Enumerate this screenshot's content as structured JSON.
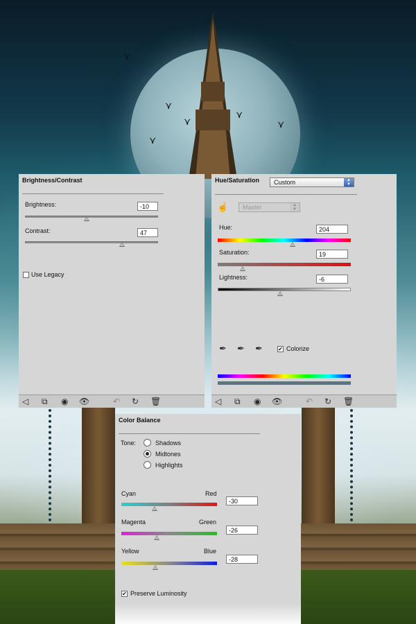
{
  "brightness_contrast": {
    "title": "Brightness/Contrast",
    "brightness_label": "Brightness:",
    "brightness_value": "-10",
    "contrast_label": "Contrast:",
    "contrast_value": "47",
    "use_legacy_label": "Use Legacy",
    "use_legacy_checked": false
  },
  "hue_saturation": {
    "title": "Hue/Saturation",
    "preset": "Custom",
    "channel": "Master",
    "hue_label": "Hue:",
    "hue_value": "204",
    "saturation_label": "Saturation:",
    "saturation_value": "19",
    "lightness_label": "Lightness:",
    "lightness_value": "-6",
    "colorize_label": "Colorize",
    "colorize_checked": true
  },
  "color_balance": {
    "title": "Color Balance",
    "tone_label": "Tone:",
    "tones": [
      "Shadows",
      "Midtones",
      "Highlights"
    ],
    "selected_tone": "Midtones",
    "cyan_label": "Cyan",
    "red_label": "Red",
    "cyan_red_value": "-30",
    "magenta_label": "Magenta",
    "green_label": "Green",
    "magenta_green_value": "-26",
    "yellow_label": "Yellow",
    "blue_label": "Blue",
    "yellow_blue_value": "-28",
    "preserve_luminosity_label": "Preserve Luminosity",
    "preserve_luminosity_checked": true
  },
  "footer_icons": [
    "back-arrow-icon",
    "clip-to-layer-icon",
    "visibility-icon",
    "eye-icon",
    "previous-state-icon",
    "reset-icon",
    "trash-icon"
  ],
  "colors": {
    "panel_bg": "#d6d6d6",
    "accent_blue": "#3b65b0"
  }
}
